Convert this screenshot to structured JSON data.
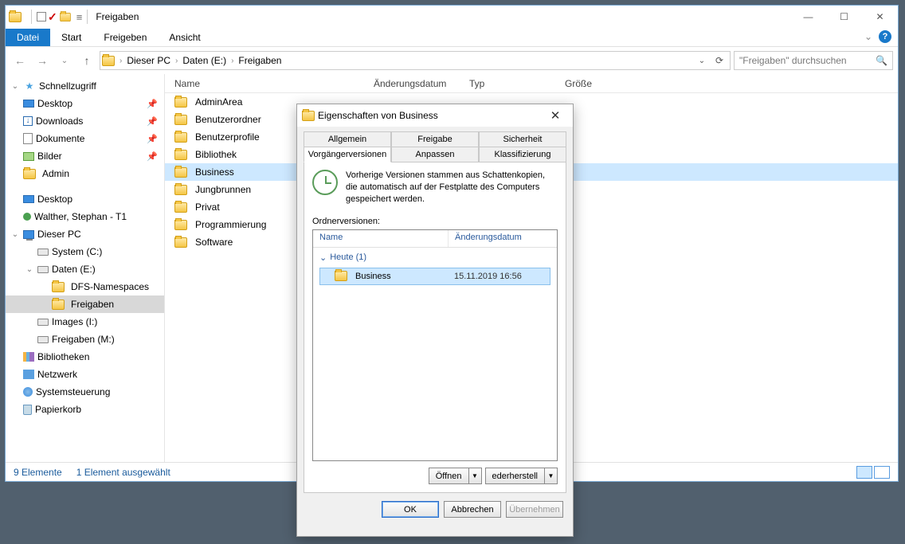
{
  "titlebar": {
    "title": "Freigaben"
  },
  "ribbon": {
    "file": "Datei",
    "tabs": [
      "Start",
      "Freigeben",
      "Ansicht"
    ]
  },
  "breadcrumbs": [
    "Dieser PC",
    "Daten (E:)",
    "Freigaben"
  ],
  "search": {
    "placeholder": "\"Freigaben\" durchsuchen"
  },
  "columns": {
    "name": "Name",
    "date": "Änderungsdatum",
    "type": "Typ",
    "size": "Größe"
  },
  "tree": {
    "quick": "Schnellzugriff",
    "quick_items": [
      "Desktop",
      "Downloads",
      "Dokumente",
      "Bilder",
      "Admin"
    ],
    "desktop": "Desktop",
    "user": "Walther, Stephan - T1",
    "pc": "Dieser PC",
    "drives": {
      "c": "System (C:)",
      "e": "Daten (E:)",
      "i": "Images (I:)",
      "m": "Freigaben (M:)"
    },
    "e_children": [
      "DFS-Namespaces",
      "Freigaben"
    ],
    "libs": "Bibliotheken",
    "net": "Netzwerk",
    "ctrl": "Systemsteuerung",
    "trash": "Papierkorb"
  },
  "files": [
    "AdminArea",
    "Benutzerordner",
    "Benutzerprofile",
    "Bibliothek",
    "Business",
    "Jungbrunnen",
    "Privat",
    "Programmierung",
    "Software"
  ],
  "selected_file_index": 4,
  "status": {
    "items": "9 Elemente",
    "selected": "1 Element ausgewählt"
  },
  "dialog": {
    "title": "Eigenschaften von Business",
    "tabs_row1": [
      "Allgemein",
      "Freigabe",
      "Sicherheit"
    ],
    "tabs_row2": [
      "Vorgängerversionen",
      "Anpassen",
      "Klassifizierung"
    ],
    "active_tab": "Vorgängerversionen",
    "info": "Vorherige Versionen stammen aus Schattenkopien, die automatisch auf der Festplatte des Computers gespeichert werden.",
    "versions_label": "Ordnerversionen:",
    "list_cols": {
      "name": "Name",
      "date": "Änderungsdatum"
    },
    "group": "Heute (1)",
    "item": {
      "name": "Business",
      "date": "15.11.2019 16:56"
    },
    "open": "Öffnen",
    "restore": "ederherstell",
    "ok": "OK",
    "cancel": "Abbrechen",
    "apply": "Übernehmen"
  }
}
